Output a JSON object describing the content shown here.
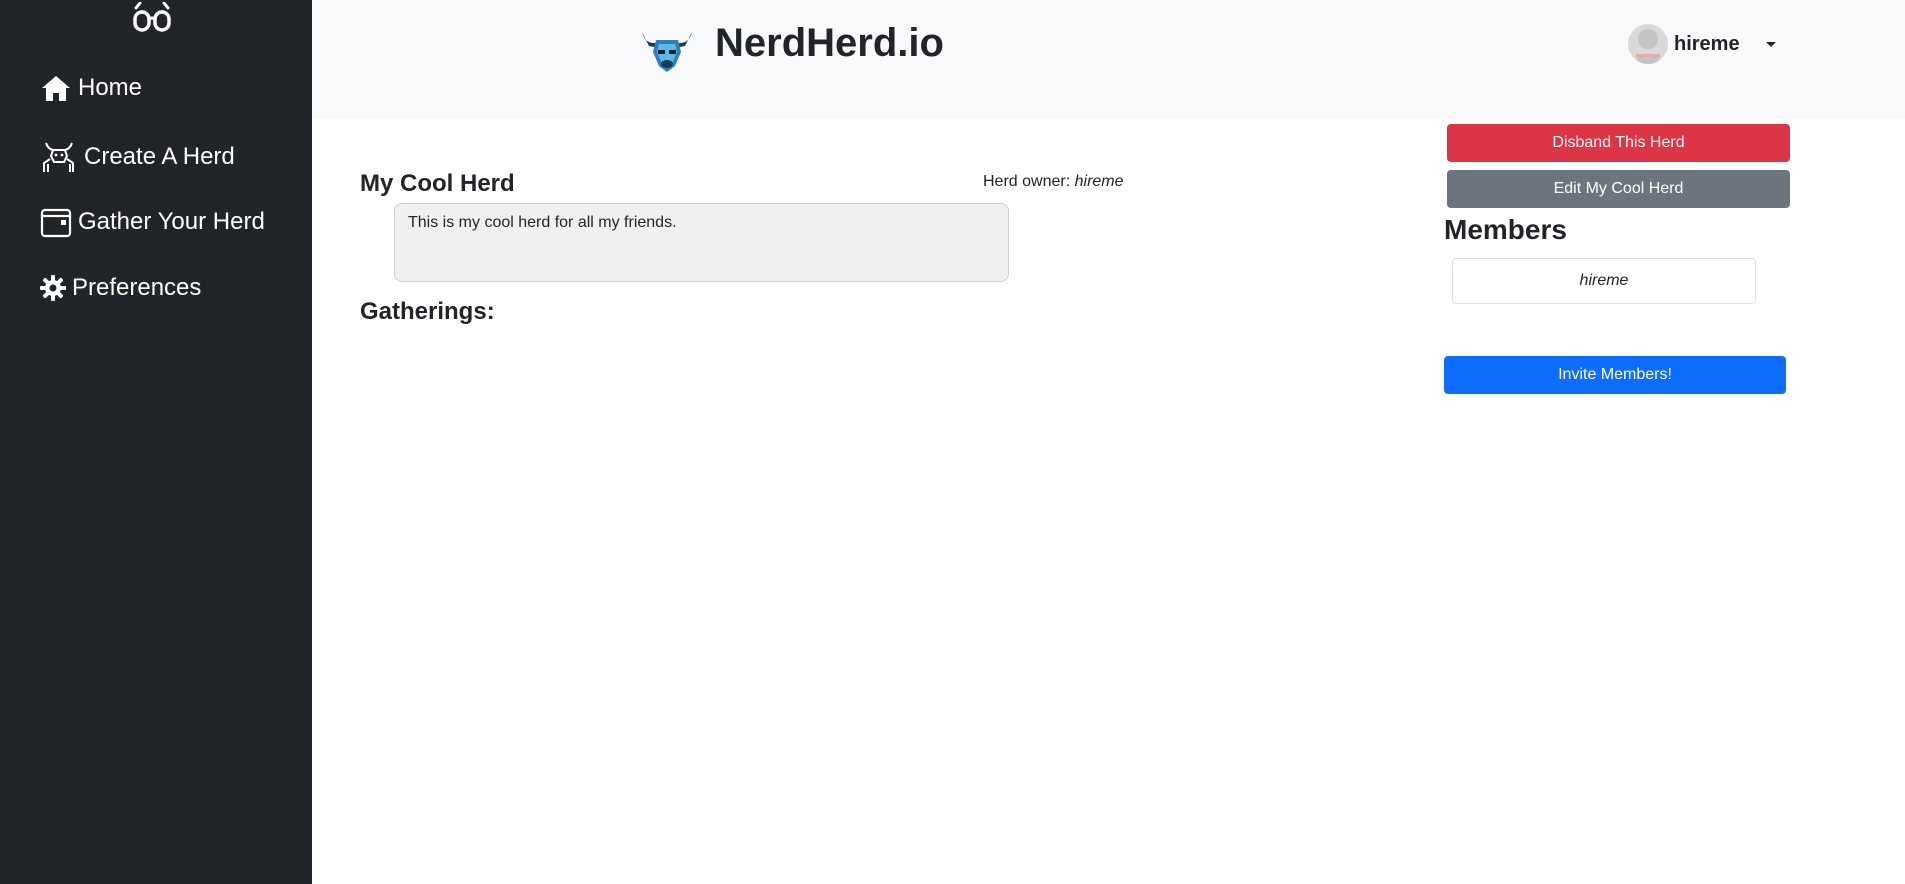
{
  "sidebar": {
    "brand_icon": "glasses-icon",
    "items": [
      {
        "label": "Home",
        "icon": "house-icon"
      },
      {
        "label": "Create A Herd",
        "icon": "bull-icon"
      },
      {
        "label": "Gather Your Herd",
        "icon": "calendar-icon"
      },
      {
        "label": "Preferences",
        "icon": "gear-icon"
      }
    ]
  },
  "header": {
    "logo_icon": "bull-logo-icon",
    "title": "NerdHerd.io",
    "user": {
      "name": "hireme",
      "avatar_icon": "avatar-icon",
      "dropdown_icon": "caret-down-icon"
    }
  },
  "herd": {
    "title": "My Cool Herd",
    "owner_label": "Herd owner:",
    "owner_name": "hireme",
    "description": "This is my cool herd for all my friends.",
    "gatherings_label": "Gatherings:"
  },
  "actions": {
    "disband_label": "Disband This Herd",
    "edit_label": "Edit My Cool Herd",
    "invite_label": "Invite Members!"
  },
  "members": {
    "title": "Members",
    "list": [
      "hireme"
    ]
  },
  "colors": {
    "sidebar_bg": "#212529",
    "header_bg": "#f8f9fa",
    "danger": "#dc3545",
    "secondary": "#6c757d",
    "primary": "#0d6efd"
  }
}
